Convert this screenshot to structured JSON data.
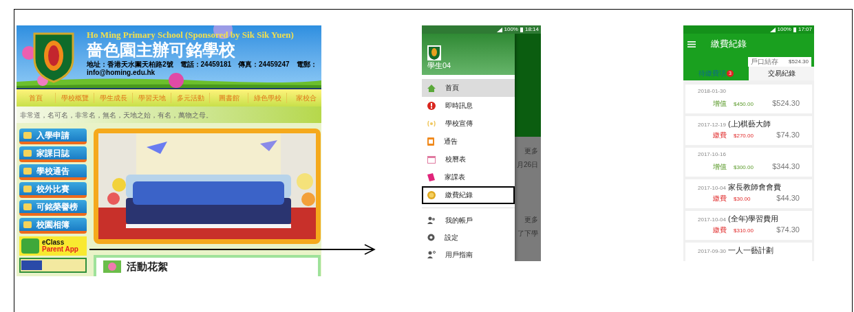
{
  "website": {
    "title_en": "Ho Ming Primary School (Sponsored by Sik Sik Yuen)",
    "title_zh": "嗇色園主辦可銘學校",
    "address": "地址：香港天水圍天柏路2號　電話：24459181　傳真：24459247　電郵：info@homing.edu.hk",
    "nav": [
      "首頁",
      "學校概覽",
      "學生成長",
      "學習天地",
      "多元活動",
      "圖書館",
      "綠色學校",
      "家校合"
    ],
    "motto": "非常道，名可名，非常名，無名，天地之始，有名，萬物之母。",
    "side_buttons": [
      "入學申請",
      "家課日誌",
      "學校通告",
      "校外比賽",
      "可銘榮譽榜",
      "校園相簿"
    ],
    "app_button": {
      "line1": "eClass",
      "line2": "Parent App"
    },
    "section_title": "活動花絮"
  },
  "drawer_phone": {
    "status_battery": "100%",
    "status_time": "18:14",
    "user_name": "學生04",
    "items": [
      {
        "label": "首頁",
        "selected": true,
        "highlighted": false
      },
      {
        "label": "即時訊息",
        "selected": false,
        "highlighted": false
      },
      {
        "label": "學校宣傳",
        "selected": false,
        "highlighted": false
      },
      {
        "label": "通告",
        "selected": false,
        "highlighted": false
      },
      {
        "label": "校曆表",
        "selected": false,
        "highlighted": false
      },
      {
        "label": "家課表",
        "selected": false,
        "highlighted": false
      },
      {
        "label": "繳費紀錄",
        "selected": false,
        "highlighted": true
      }
    ],
    "account_items": [
      {
        "label": "我的帳戶"
      },
      {
        "label": "設定"
      },
      {
        "label": "用戶指南"
      }
    ],
    "background_texts": [
      "更多",
      "月26日",
      "更多",
      "了下學"
    ]
  },
  "fees_phone": {
    "status_battery": "100%",
    "status_time": "17:07",
    "title": "繳費紀錄",
    "balance_label": "戶口結存",
    "balance": "$524.30",
    "tabs": [
      {
        "label": "待繳費項",
        "badge": "3",
        "selected": false
      },
      {
        "label": "交易紀錄",
        "selected": true
      }
    ],
    "records": [
      {
        "date": "2018-01-30",
        "kind": "top-up",
        "type": "增值",
        "amount": "$450.00",
        "balance": "$524.30"
      },
      {
        "date": "2017-12-19",
        "title": "(上)棋藝大師",
        "kind": "payment",
        "type": "繳費",
        "amount": "$270.00",
        "balance": "$74.30"
      },
      {
        "date": "2017-10-16",
        "kind": "top-up",
        "type": "增值",
        "amount": "$300.00",
        "balance": "$344.30"
      },
      {
        "date": "2017-10-04",
        "title": "家長教師會會費",
        "kind": "payment",
        "type": "繳費",
        "amount": "$30.00",
        "balance": "$44.30"
      },
      {
        "date": "2017-10-04",
        "title": "(全年)學習費用",
        "kind": "payment",
        "type": "繳費",
        "amount": "$310.00",
        "balance": "$74.30"
      },
      {
        "date": "2017-09-30",
        "title": "一人一藝計劃",
        "kind": "partial"
      }
    ]
  }
}
